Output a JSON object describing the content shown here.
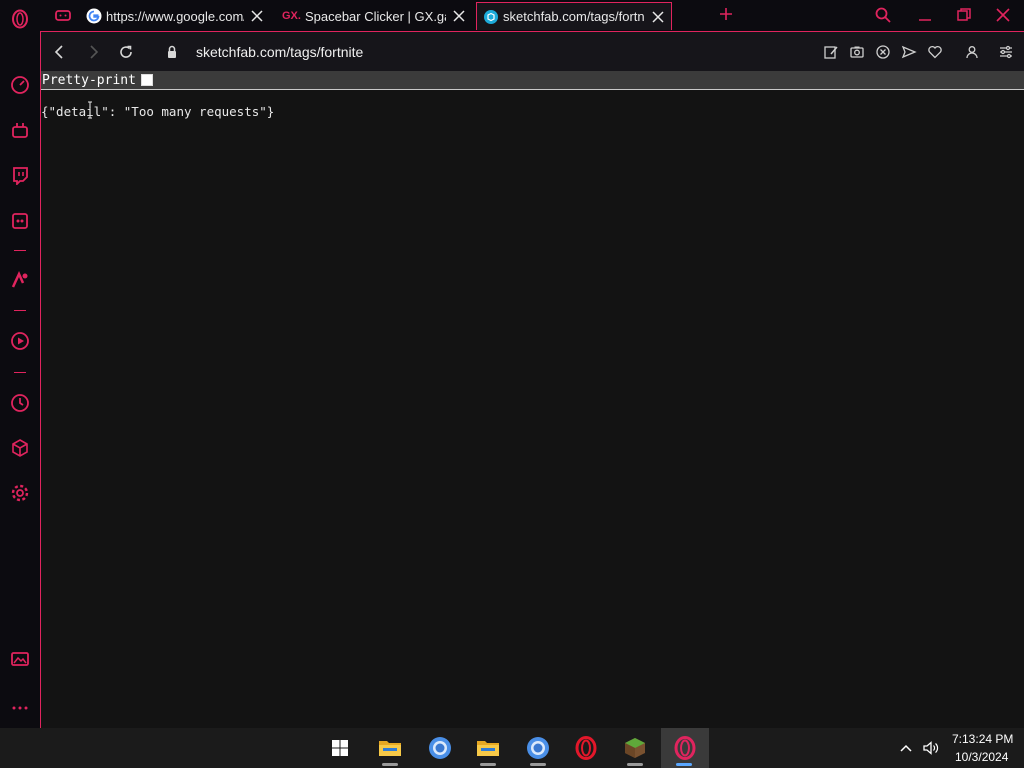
{
  "colors": {
    "accent": "#e0245e",
    "background": "#0c0b10",
    "page_bg": "#131313"
  },
  "tabs": [
    {
      "favicon": "google-icon",
      "title": "https://www.google.com/se",
      "active": false
    },
    {
      "favicon": "gx-games-icon",
      "badge": "GX.",
      "title": "Spacebar Clicker | GX.games",
      "active": false
    },
    {
      "favicon": "sketchfab-icon",
      "title": "sketchfab.com/tags/fortnite",
      "active": true
    }
  ],
  "address_bar": {
    "url": "sketchfab.com/tags/fortnite"
  },
  "page": {
    "pretty_print_label": "Pretty-print",
    "json_text": "{\"detail\": \"Too many requests\"}"
  },
  "sidebar_icons": [
    "speed-dial-icon",
    "gx-control-icon",
    "twitch-icon",
    "discord-icon",
    "aria-icon",
    "player-icon",
    "history-icon",
    "extensions-icon",
    "settings-icon",
    "wallpaper-icon",
    "more-icon"
  ],
  "taskbar": {
    "apps": [
      "windows-start-icon",
      "file-explorer-icon",
      "chrome-icon",
      "file-explorer-icon",
      "chrome-icon",
      "opera-icon",
      "minecraft-icon",
      "opera-gx-icon"
    ],
    "time": "7:13:24 PM",
    "date": "10/3/2024"
  }
}
